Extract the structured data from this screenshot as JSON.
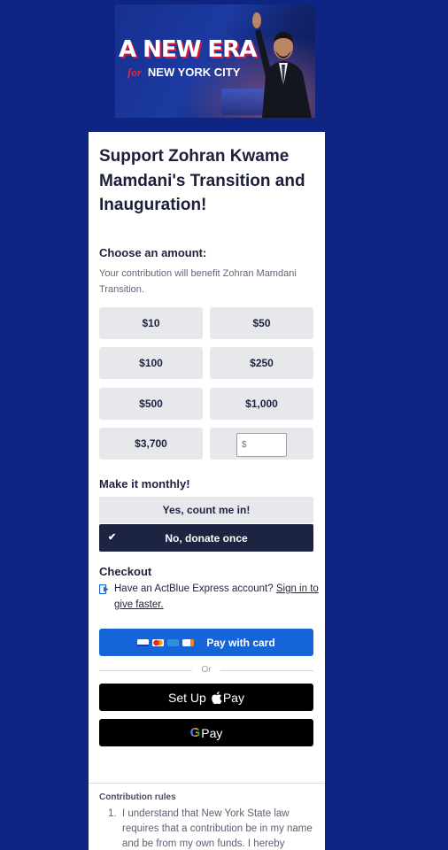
{
  "banner": {
    "title": "A NEW ERA",
    "for_word": "for",
    "subtitle": "NEW YORK CITY"
  },
  "page": {
    "title": "Support Zohran Kwame Mamdani's Transition and Inauguration!"
  },
  "amount_section": {
    "heading": "Choose an amount:",
    "benefit_text": "Your contribution will benefit Zohran Mamdani Transition.",
    "amounts": [
      "$10",
      "$50",
      "$100",
      "$250",
      "$500",
      "$1,000",
      "$3,700"
    ],
    "custom_placeholder": "$"
  },
  "monthly": {
    "heading": "Make it monthly!",
    "yes_label": "Yes, count me in!",
    "no_label": "No, donate once",
    "selected": "No, donate once"
  },
  "checkout": {
    "heading": "Checkout",
    "express_text": "Have an ActBlue Express account?",
    "express_link": "Sign in to give faster.",
    "pay_card_label": "Pay with card",
    "card_brands": [
      "visa",
      "mastercard",
      "amex",
      "discover"
    ],
    "or_label": "Or",
    "apple_pay_prefix": "Set Up",
    "apple_pay_label": "Pay",
    "google_pay_label": "Pay"
  },
  "rules": {
    "heading": "Contribution rules",
    "items": [
      {
        "num": "1.",
        "text": "I understand that New York State law requires that a contribution be in my name and be from my own funds. I hereby"
      }
    ]
  },
  "colors": {
    "background": "#0f2583",
    "accent_blue": "#1565d8",
    "selected_dark": "#1d2442",
    "banner_red": "#d8193c"
  }
}
